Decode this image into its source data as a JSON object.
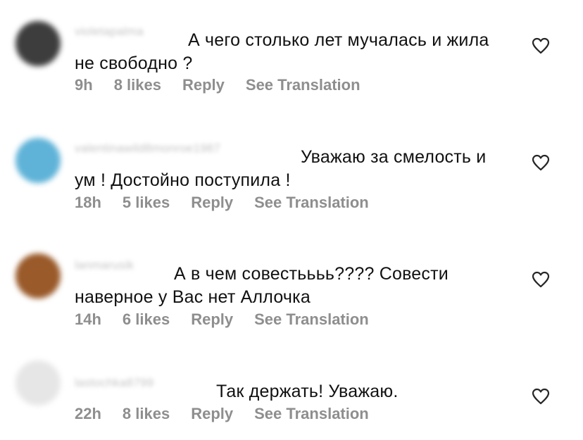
{
  "comments": [
    {
      "username": "violetapalma",
      "text": "А чего столько лет мучалась и жила не свободно ?",
      "time": "9h",
      "likes": "8 likes",
      "reply": "Reply",
      "translate": "See Translation",
      "avatar_color": "#3d3d3d",
      "icon": "heart-outline-icon"
    },
    {
      "username": "valentinawild8monroe1987",
      "text": "Уважаю за смелость и ум ! Достойно поступила !",
      "time": "18h",
      "likes": "5 likes",
      "reply": "Reply",
      "translate": "See Translation",
      "avatar_color": "#5fb3d8",
      "icon": "heart-outline-icon"
    },
    {
      "username": "lanmarusik",
      "text": "А в чем совестьььь???? Совести наверное у Вас нет Аллочка",
      "time": "14h",
      "likes": "6 likes",
      "reply": "Reply",
      "translate": "See Translation",
      "avatar_color": "#9a5a2a",
      "icon": "heart-outline-icon"
    },
    {
      "username": "lastochka8799",
      "text": "Так держать! Уважаю.",
      "time": "22h",
      "likes": "8 likes",
      "reply": "Reply",
      "translate": "See Translation",
      "avatar_color": "#e6e6e6",
      "icon": "heart-outline-icon"
    }
  ]
}
